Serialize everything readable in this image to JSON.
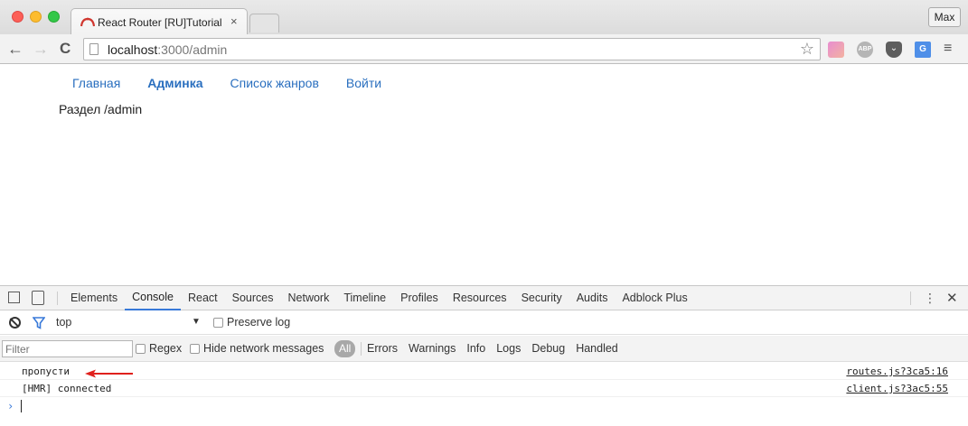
{
  "browser": {
    "tab_title": "React Router [RU]Tutorial",
    "tab_close": "×",
    "profile_name": "Max",
    "url_host": "localhost",
    "url_rest": ":3000/admin",
    "ext_abp": "ABP",
    "ext_pocket": "⌄",
    "ext_translate": "G"
  },
  "page": {
    "nav": [
      {
        "label": "Главная",
        "active": false
      },
      {
        "label": "Админка",
        "active": true
      },
      {
        "label": "Список жанров",
        "active": false
      },
      {
        "label": "Войти",
        "active": false
      }
    ],
    "section_text": "Раздел /admin"
  },
  "devtools": {
    "tabs": [
      "Elements",
      "Console",
      "React",
      "Sources",
      "Network",
      "Timeline",
      "Profiles",
      "Resources",
      "Security",
      "Audits",
      "Adblock Plus"
    ],
    "active_tab": "Console",
    "context": "top",
    "preserve_log_label": "Preserve log",
    "filter_placeholder": "Filter",
    "regex_label": "Regex",
    "hide_network_label": "Hide network messages",
    "levels": [
      "All",
      "Errors",
      "Warnings",
      "Info",
      "Logs",
      "Debug",
      "Handled"
    ],
    "active_level": "All",
    "messages": [
      {
        "text": "пропусти",
        "source": "routes.js?3ca5:16",
        "highlighted": true
      },
      {
        "text": "[HMR] connected",
        "source": "client.js?3ac5:55",
        "highlighted": false
      }
    ],
    "prompt": "›"
  },
  "colors": {
    "link": "#2a6fbf",
    "devtools_accent": "#3879d9",
    "annotation_arrow": "#e0201c"
  }
}
